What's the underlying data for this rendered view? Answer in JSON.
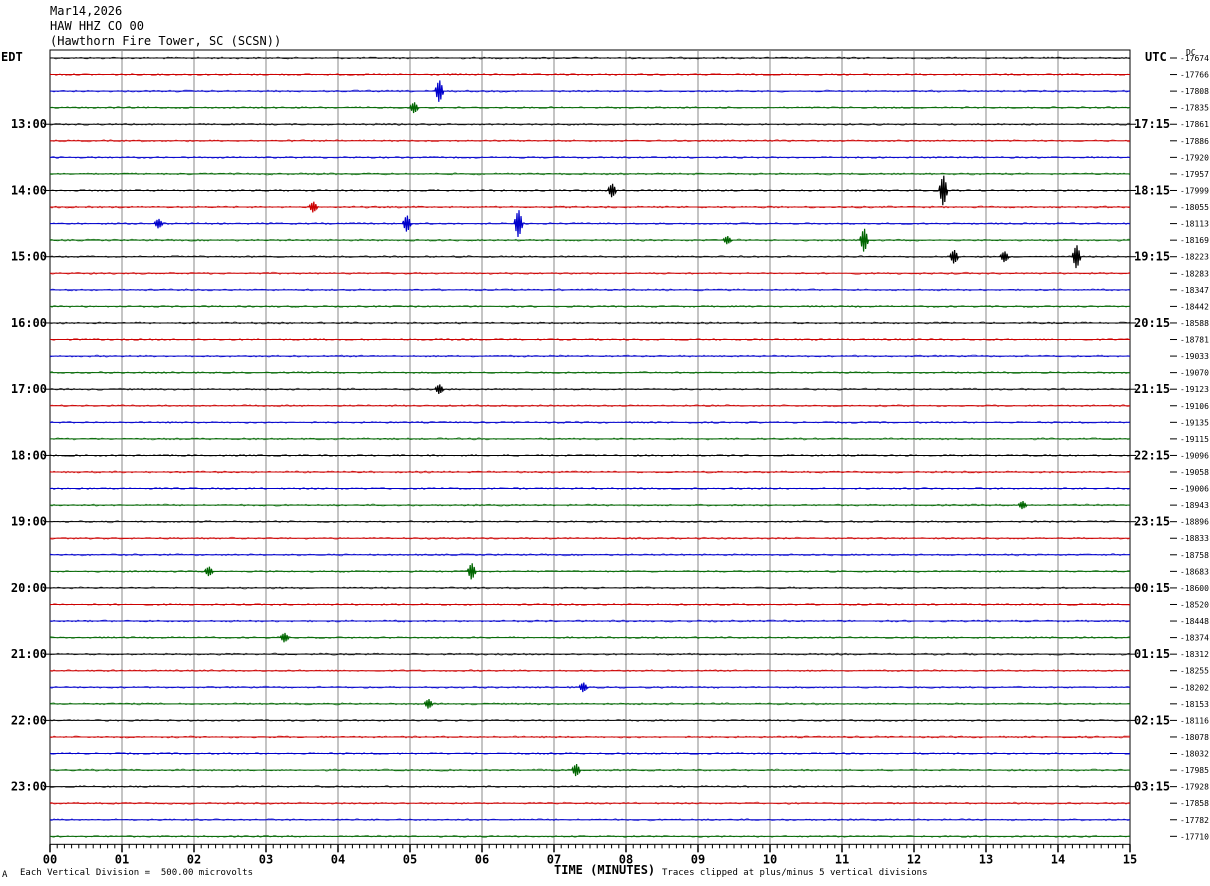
{
  "header": {
    "date": "Mar14,2026",
    "channel": "HAW HHZ CO 00",
    "station": "(Hawthorn Fire Tower, SC (SCSN))"
  },
  "left_tz": "EDT",
  "right_tz": "UTC",
  "dc_label": "DC",
  "footer": {
    "scale_note": "Each Vertical Division =  500.00 microvolts",
    "xaxis_title": "TIME (MINUTES)",
    "clip_note": "Traces clipped at plus/minus 5 vertical divisions",
    "corner_mark": "A"
  },
  "chart_data": {
    "type": "line",
    "x_label": "TIME (MINUTES)",
    "x_ticks": [
      "00",
      "01",
      "02",
      "03",
      "04",
      "05",
      "06",
      "07",
      "08",
      "09",
      "10",
      "11",
      "12",
      "13",
      "14",
      "15"
    ],
    "xlim": [
      0,
      15
    ],
    "traces_per_hour": 4,
    "trace_minutes": 15,
    "trace_colors": [
      "#000000",
      "#cc0000",
      "#0000cc",
      "#006600"
    ],
    "left_hour_labels": [
      "13:00",
      "14:00",
      "15:00",
      "16:00",
      "17:00",
      "18:00",
      "19:00",
      "20:00",
      "21:00",
      "22:00",
      "23:00"
    ],
    "right_hour_labels": [
      "17:15",
      "18:15",
      "19:15",
      "20:15",
      "21:15",
      "22:15",
      "23:15",
      "00:15",
      "01:15",
      "02:15",
      "03:15"
    ],
    "dc_offsets": [
      -17674,
      -17766,
      -17808,
      -17835,
      -17861,
      -17886,
      -17920,
      -17957,
      -17999,
      -18055,
      -18113,
      -18169,
      -18223,
      -18283,
      -18347,
      -18442,
      -18588,
      -18781,
      -19033,
      -19070,
      -19123,
      -19106,
      -19135,
      -19115,
      -19096,
      -19058,
      -19006,
      -18943,
      -18896,
      -18833,
      -18758,
      -18683,
      -18600,
      -18520,
      -18448,
      -18374,
      -18312,
      -18255,
      -18202,
      -18153,
      -18116,
      -18078,
      -18032,
      -17985,
      -17928,
      -17858,
      -17782,
      -17710
    ],
    "events": [
      {
        "trace": 2,
        "minute": 5.4,
        "amp": 1.6
      },
      {
        "trace": 3,
        "minute": 5.05,
        "amp": 0.8
      },
      {
        "trace": 8,
        "minute": 7.8,
        "amp": 1.0
      },
      {
        "trace": 8,
        "minute": 12.4,
        "amp": 2.2
      },
      {
        "trace": 9,
        "minute": 3.65,
        "amp": 0.8
      },
      {
        "trace": 10,
        "minute": 1.5,
        "amp": 0.7
      },
      {
        "trace": 10,
        "minute": 4.95,
        "amp": 1.2
      },
      {
        "trace": 10,
        "minute": 6.5,
        "amp": 2.0
      },
      {
        "trace": 11,
        "minute": 9.4,
        "amp": 0.6
      },
      {
        "trace": 11,
        "minute": 11.3,
        "amp": 1.7
      },
      {
        "trace": 12,
        "minute": 12.55,
        "amp": 1.0
      },
      {
        "trace": 12,
        "minute": 13.25,
        "amp": 0.8
      },
      {
        "trace": 12,
        "minute": 14.25,
        "amp": 1.7
      },
      {
        "trace": 20,
        "minute": 5.4,
        "amp": 0.7
      },
      {
        "trace": 27,
        "minute": 13.5,
        "amp": 0.6
      },
      {
        "trace": 31,
        "minute": 2.2,
        "amp": 0.7
      },
      {
        "trace": 31,
        "minute": 5.85,
        "amp": 1.2
      },
      {
        "trace": 35,
        "minute": 3.25,
        "amp": 0.7
      },
      {
        "trace": 38,
        "minute": 7.4,
        "amp": 0.7
      },
      {
        "trace": 39,
        "minute": 5.25,
        "amp": 0.7
      },
      {
        "trace": 43,
        "minute": 7.3,
        "amp": 0.9
      }
    ]
  }
}
